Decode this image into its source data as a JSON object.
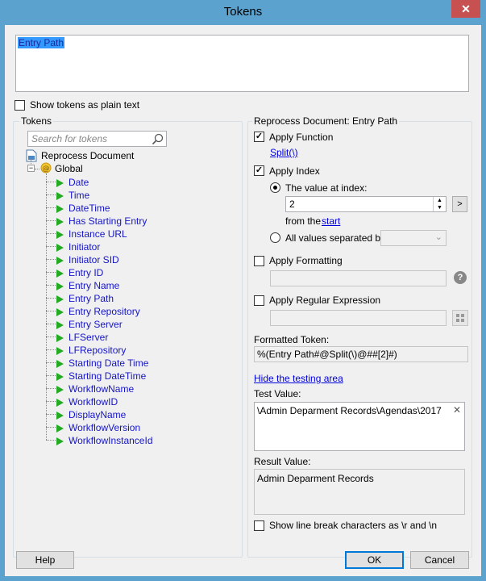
{
  "window": {
    "title": "Tokens",
    "close_glyph": "✕"
  },
  "entry_box": {
    "value": "Entry Path"
  },
  "show_plain": {
    "label": "Show tokens as plain text",
    "checked": false
  },
  "tokens_panel": {
    "group_label": "Tokens",
    "search_placeholder": "Search for tokens",
    "root": "Reprocess Document",
    "global": "Global",
    "items": [
      "Date",
      "Time",
      "DateTime",
      "Has Starting Entry",
      "Instance URL",
      "Initiator",
      "Initiator SID",
      "Entry ID",
      "Entry Name",
      "Entry Path",
      "Entry Repository",
      "Entry Server",
      "LFServer",
      "LFRepository",
      "Starting Date Time",
      "Starting DateTime",
      "WorkflowName",
      "WorkflowID",
      "DisplayName",
      "WorkflowVersion",
      "WorkflowInstanceId"
    ]
  },
  "right_panel": {
    "group_label": "Reprocess Document: Entry Path",
    "apply_function": {
      "label": "Apply Function",
      "checked": true,
      "link": "Split(\\)"
    },
    "apply_index": {
      "label": "Apply Index",
      "checked": true,
      "value_at_index_label": "The value at index:",
      "index_value": "2",
      "from_the": "from the",
      "start_link": "start",
      "nav_button": ">",
      "all_values_label": "All values separated by:"
    },
    "apply_formatting": {
      "label": "Apply Formatting",
      "checked": false,
      "help": "?"
    },
    "apply_regex": {
      "label": "Apply Regular Expression",
      "checked": false
    },
    "formatted_token": {
      "label": "Formatted Token:",
      "value": "%(Entry Path#@Split(\\)@##[2]#)"
    },
    "hide_testing_link": "Hide the testing area",
    "test_value": {
      "label": "Test Value:",
      "value": "\\Admin Deparment Records\\Agendas\\2017",
      "clear": "✕"
    },
    "result_value": {
      "label": "Result Value:",
      "value": "Admin Deparment Records"
    },
    "show_line_break": {
      "label": "Show line break characters as \\r and \\n",
      "checked": false
    }
  },
  "footer": {
    "help": "Help",
    "ok": "OK",
    "cancel": "Cancel"
  }
}
